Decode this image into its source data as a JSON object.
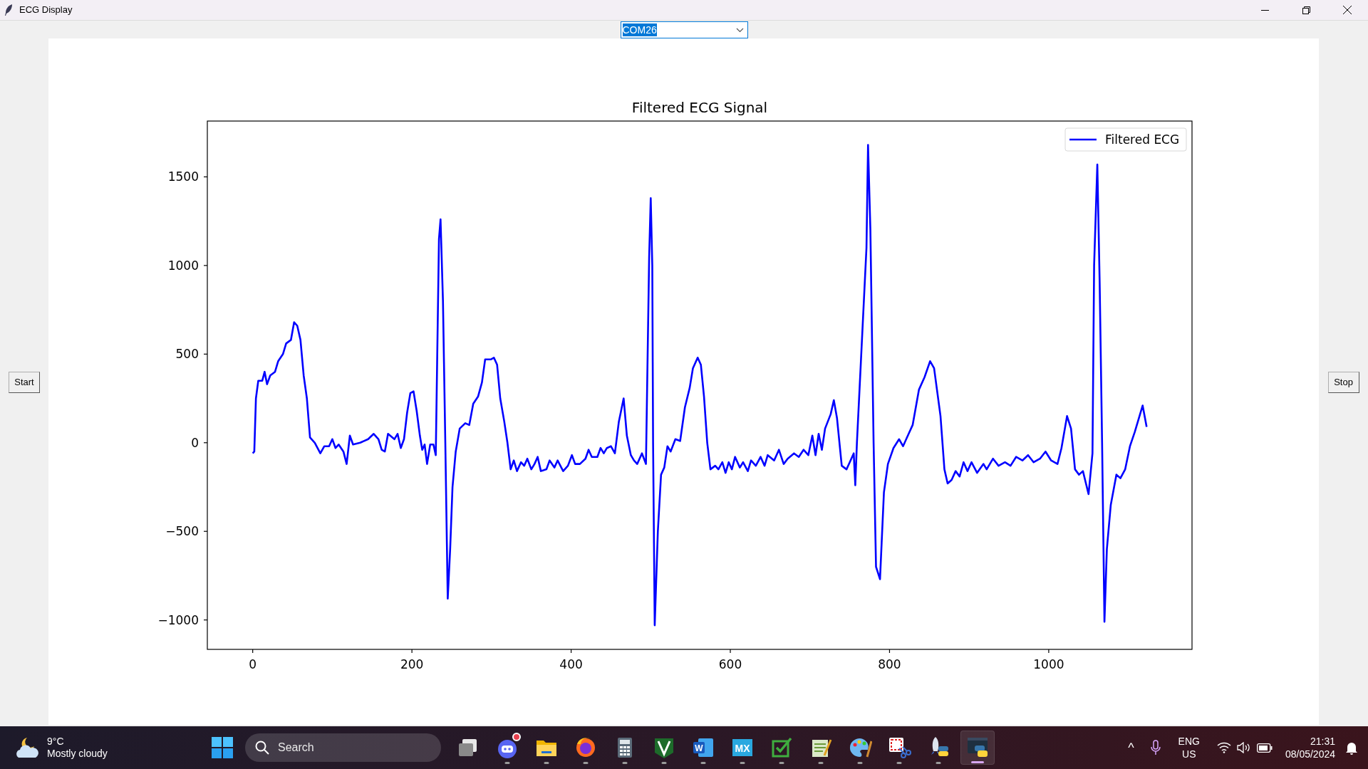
{
  "window": {
    "title": "ECG Display"
  },
  "port_select": {
    "value": "COM26"
  },
  "start_button": {
    "label": "Start"
  },
  "stop_button": {
    "label": "Stop"
  },
  "chart": {
    "chart_data": {
      "type": "line",
      "title": "Filtered ECG Signal",
      "xlim": [
        -57,
        1180
      ],
      "ylim": [
        -1166,
        1815
      ],
      "xticks": [
        0,
        200,
        400,
        600,
        800,
        1000
      ],
      "yticks": [
        {
          "value": -1000,
          "label": "−1000"
        },
        {
          "value": -500,
          "label": "−500"
        },
        {
          "value": 0,
          "label": "0"
        },
        {
          "value": 500,
          "label": "500"
        },
        {
          "value": 1000,
          "label": "1000"
        },
        {
          "value": 1500,
          "label": "1500"
        }
      ],
      "x": [
        0,
        2,
        4,
        7,
        12,
        15,
        18,
        22,
        28,
        32,
        38,
        42,
        48,
        52,
        56,
        60,
        64,
        68,
        72,
        78,
        85,
        90,
        96,
        100,
        104,
        108,
        114,
        118,
        122,
        126,
        135,
        145,
        152,
        158,
        162,
        166,
        170,
        178,
        182,
        186,
        190,
        194,
        198,
        202,
        206,
        210,
        213,
        216,
        219,
        223,
        227,
        230,
        234,
        236,
        239,
        242,
        245,
        248,
        251,
        255,
        260,
        267,
        272,
        277,
        283,
        288,
        292,
        299,
        303,
        307,
        311,
        316,
        320,
        324,
        328,
        332,
        337,
        341,
        345,
        350,
        354,
        358,
        362,
        369,
        373,
        379,
        383,
        390,
        396,
        401,
        405,
        411,
        418,
        422,
        426,
        433,
        437,
        441,
        445,
        450,
        455,
        460,
        466,
        470,
        475,
        479,
        483,
        489,
        494,
        498,
        500,
        502,
        503,
        505,
        509,
        513,
        517,
        521,
        525,
        531,
        537,
        543,
        549,
        553,
        559,
        563,
        567,
        571,
        575,
        581,
        585,
        590,
        594,
        598,
        602,
        606,
        612,
        616,
        622,
        626,
        632,
        638,
        643,
        647,
        655,
        661,
        667,
        672,
        680,
        686,
        692,
        698,
        703,
        707,
        711,
        715,
        719,
        726,
        730,
        734,
        740,
        746,
        750,
        755,
        757,
        759,
        771,
        773,
        776,
        780,
        783,
        788,
        793,
        798,
        805,
        812,
        817,
        824,
        829,
        837,
        844,
        851,
        856,
        864,
        869,
        873,
        878,
        883,
        888,
        893,
        898,
        903,
        910,
        918,
        922,
        930,
        937,
        945,
        952,
        959,
        967,
        974,
        981,
        989,
        996,
        1003,
        1011,
        1016,
        1023,
        1028,
        1033,
        1038,
        1043,
        1050,
        1055,
        1057,
        1061,
        1064,
        1067,
        1070,
        1073,
        1078,
        1085,
        1090,
        1096,
        1102,
        1108,
        1114,
        1118,
        1123
      ],
      "series": [
        {
          "name": "Filtered ECG",
          "color": "#0000ff",
          "values": [
            -60,
            -50,
            250,
            350,
            350,
            400,
            330,
            380,
            400,
            460,
            500,
            560,
            580,
            680,
            660,
            580,
            380,
            250,
            30,
            0,
            -60,
            -20,
            -20,
            20,
            -30,
            -10,
            -50,
            -120,
            40,
            -10,
            0,
            20,
            50,
            20,
            -40,
            -50,
            50,
            20,
            50,
            -30,
            20,
            170,
            280,
            290,
            180,
            40,
            -40,
            -10,
            -120,
            -10,
            -10,
            -70,
            1150,
            1260,
            800,
            0,
            -880,
            -600,
            -250,
            -50,
            80,
            110,
            100,
            220,
            260,
            340,
            470,
            470,
            480,
            440,
            250,
            120,
            0,
            -150,
            -100,
            -160,
            -110,
            -130,
            -90,
            -150,
            -120,
            -80,
            -160,
            -150,
            -100,
            -140,
            -100,
            -160,
            -130,
            -70,
            -120,
            -120,
            -90,
            -40,
            -80,
            -80,
            -30,
            -60,
            -30,
            -20,
            -60,
            120,
            250,
            40,
            -70,
            -100,
            -120,
            -60,
            -120,
            1050,
            1380,
            1000,
            0,
            -1030,
            -500,
            -180,
            -140,
            -20,
            -50,
            20,
            10,
            200,
            310,
            420,
            480,
            440,
            260,
            0,
            -150,
            -130,
            -150,
            -110,
            -170,
            -110,
            -150,
            -80,
            -140,
            -110,
            -160,
            -100,
            -130,
            -80,
            -130,
            -70,
            -100,
            -40,
            -120,
            -90,
            -60,
            -80,
            -40,
            -70,
            40,
            -70,
            50,
            -40,
            80,
            160,
            240,
            140,
            -130,
            -150,
            -110,
            -60,
            -240,
            0,
            1100,
            1680,
            1200,
            0,
            -700,
            -770,
            -280,
            -120,
            -30,
            20,
            -20,
            50,
            100,
            300,
            370,
            460,
            420,
            150,
            -150,
            -230,
            -210,
            -160,
            -190,
            -110,
            -160,
            -110,
            -170,
            -120,
            -150,
            -90,
            -130,
            -110,
            -130,
            -80,
            -100,
            -70,
            -110,
            -90,
            -50,
            -100,
            -120,
            -30,
            150,
            80,
            -150,
            -180,
            -160,
            -290,
            -60,
            1000,
            1570,
            900,
            0,
            -1010,
            -600,
            -350,
            -180,
            -200,
            -150,
            -20,
            60,
            150,
            210,
            90
          ]
        }
      ]
    }
  },
  "taskbar": {
    "weather": {
      "temperature": "9°C",
      "condition": "Mostly cloudy"
    },
    "search": {
      "placeholder": "Search"
    },
    "apps": [
      {
        "kind": "taskview",
        "running": false,
        "selected": false
      },
      {
        "kind": "chat",
        "running": true,
        "badge": true,
        "selected": false
      },
      {
        "kind": "folder",
        "running": true,
        "selected": false
      },
      {
        "kind": "browser",
        "running": true,
        "selected": false
      },
      {
        "kind": "calculator",
        "running": true,
        "selected": false
      },
      {
        "kind": "greenv",
        "running": true,
        "selected": false
      },
      {
        "kind": "word",
        "text": "W",
        "running": true,
        "selected": false
      },
      {
        "kind": "mx",
        "text": "MX",
        "running": true,
        "selected": false
      },
      {
        "kind": "checkedit",
        "running": true,
        "selected": false
      },
      {
        "kind": "notepad",
        "running": true,
        "selected": false
      },
      {
        "kind": "palette",
        "running": true,
        "selected": false
      },
      {
        "kind": "snip",
        "running": true,
        "selected": false
      },
      {
        "kind": "rocket",
        "running": true,
        "selected": false
      },
      {
        "kind": "python",
        "running": true,
        "selected": true
      }
    ],
    "tray": {
      "chevron": "^",
      "language": "ENG",
      "region": "US",
      "time": "21:31",
      "date": "08/05/2024"
    }
  }
}
